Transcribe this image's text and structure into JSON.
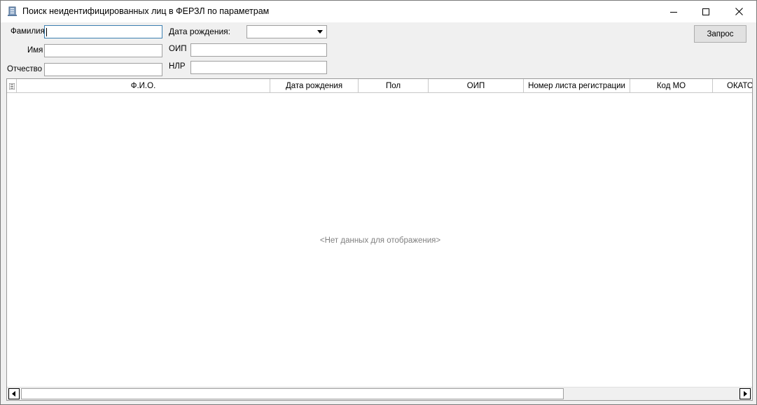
{
  "window": {
    "title": "Поиск неидентифицированных лиц в ФЕРЗЛ по параметрам",
    "icon": "app-icon"
  },
  "filters": {
    "surname_label": "Фамилия",
    "surname_value": "",
    "name_label": "Имя",
    "name_value": "",
    "patronymic_label": "Отчество",
    "patronymic_value": "",
    "birthdate_label": "Дата рождения:",
    "birthdate_value": "",
    "oip_label": "ОИП",
    "oip_value": "",
    "nlr_label": "НЛР",
    "nlr_value": "",
    "query_button": "Запрос"
  },
  "grid": {
    "columns": [
      "Ф.И.О.",
      "Дата рождения",
      "Пол",
      "ОИП",
      "Номер листа регистрации",
      "Код МО",
      "ОКАТО"
    ],
    "rows": [],
    "empty_message": "<Нет данных для отображения>"
  },
  "colors": {
    "background": "#f0f0f0",
    "focus_border": "#3c7fb1",
    "empty_text": "#808080"
  }
}
